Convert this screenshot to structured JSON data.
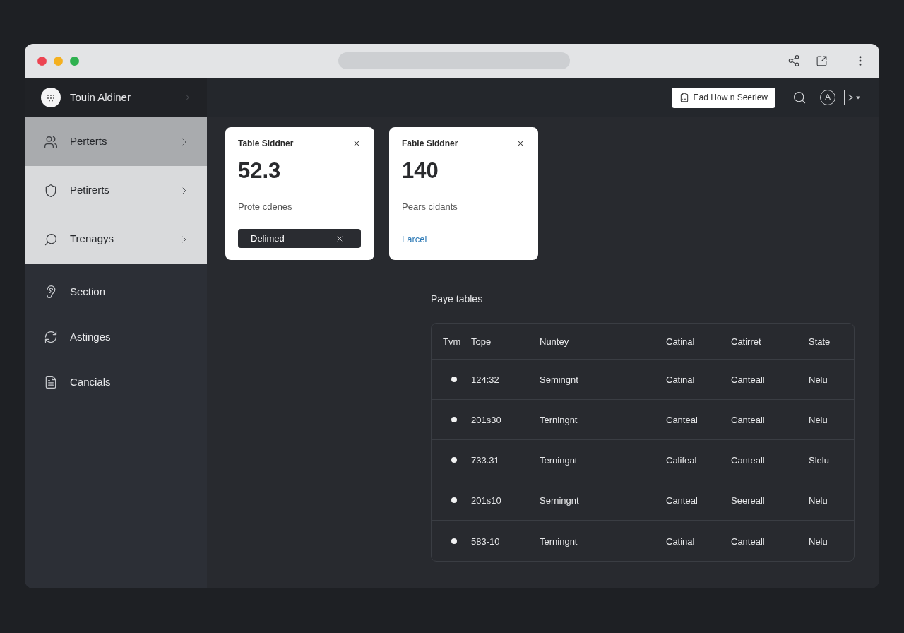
{
  "app": {
    "name": "Touin Aldiner"
  },
  "sidebar": {
    "items": [
      {
        "label": "Perterts",
        "kind": "group",
        "selected": true
      },
      {
        "label": "Petirerts",
        "kind": "group",
        "selected": false
      },
      {
        "label": "Trenagys",
        "kind": "group",
        "selected": false
      },
      {
        "label": "Section",
        "kind": "link",
        "selected": false
      },
      {
        "label": "Astinges",
        "kind": "link",
        "selected": false
      },
      {
        "label": "Cancials",
        "kind": "link",
        "selected": false
      }
    ]
  },
  "header": {
    "action_button": "Ead How n Seeriew",
    "avatar_letter": "A"
  },
  "cards": [
    {
      "title": "Table Siddner",
      "value": "52.3",
      "caption": "Prote cdenes",
      "footer": {
        "kind": "chip",
        "label": "Delimed"
      }
    },
    {
      "title": "Fable Siddner",
      "value": "140",
      "caption": "Pears cidants",
      "footer": {
        "kind": "link",
        "label": "Larcel"
      }
    }
  ],
  "table": {
    "title": "Paye tables",
    "columns": [
      "Tvm",
      "Tope",
      "Nuntey",
      "Catinal",
      "Catirret",
      "State"
    ],
    "rows": [
      {
        "cells": [
          "",
          "124:32",
          "Semingnt",
          "Catinal",
          "Canteall",
          "Nelu"
        ]
      },
      {
        "cells": [
          "",
          "201s30",
          "Terningnt",
          "Canteal",
          "Canteall",
          "Nelu"
        ]
      },
      {
        "cells": [
          "",
          "733.31",
          "Terningnt",
          "Califeal",
          "Canteall",
          "Slelu"
        ]
      },
      {
        "cells": [
          "",
          "201s10",
          "Serningnt",
          "Canteal",
          "Seereall",
          "Nelu"
        ]
      },
      {
        "cells": [
          "",
          "583-10",
          "Terningnt",
          "Catinal",
          "Canteall",
          "Nelu"
        ]
      }
    ]
  }
}
